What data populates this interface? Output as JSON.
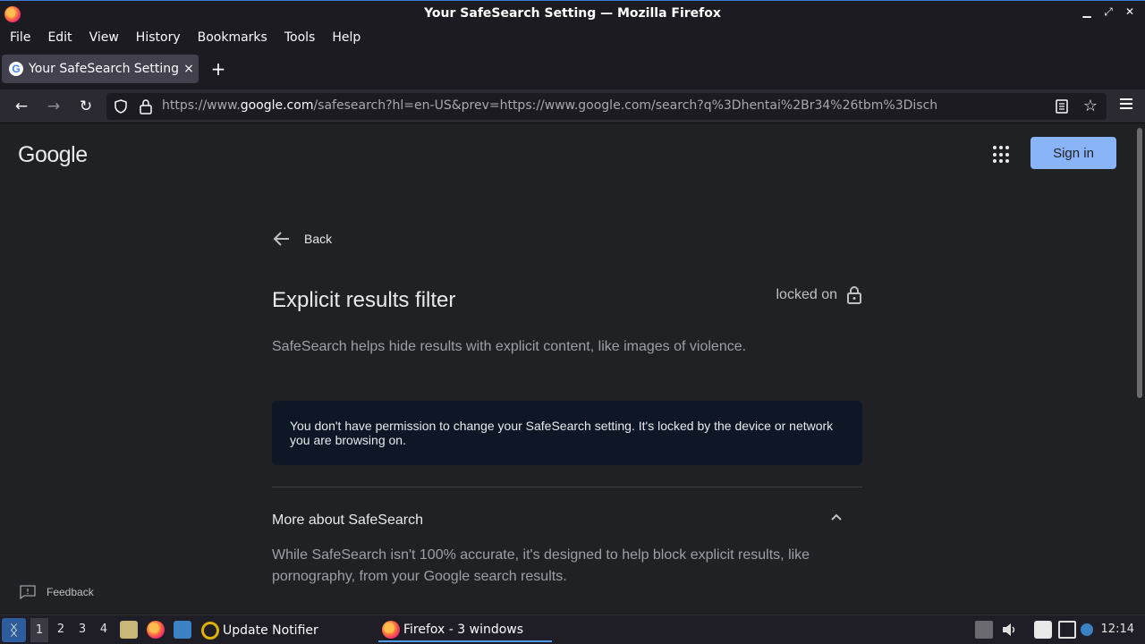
{
  "window": {
    "title": "Your SafeSearch Setting — Mozilla Firefox",
    "controls": {
      "minimize": "▁",
      "restore": "⤢",
      "close": "✕"
    }
  },
  "menu": {
    "file": "File",
    "edit": "Edit",
    "view": "View",
    "history": "History",
    "bookmarks": "Bookmarks",
    "tools": "Tools",
    "help": "Help"
  },
  "tab": {
    "label": "Your SafeSearch Setting",
    "close": "×",
    "favicon": "G"
  },
  "newtab": "+",
  "nav": {
    "back": "←",
    "forward": "→",
    "reload": "↻",
    "url_prefix": "https://www.",
    "url_domain": "google.com",
    "url_rest": "/safesearch?hl=en-US&prev=https://www.google.com/search?q%3Dhentai%2Br34%26tbm%3Disch",
    "star": "☆"
  },
  "page": {
    "logo": "Google",
    "signin": "Sign in",
    "back": "Back",
    "title": "Explicit results filter",
    "locked_label": "locked on",
    "description": "SafeSearch helps hide results with explicit content, like images of violence.",
    "notice": "You don't have permission to change your SafeSearch setting. It's locked by the device or network you are browsing on.",
    "more_title": "More about SafeSearch",
    "more_body": "While SafeSearch isn't 100% accurate, it's designed to help block explicit results, like pornography, from your Google search results.",
    "feedback": "Feedback"
  },
  "taskbar": {
    "workspaces": [
      "1",
      "2",
      "3",
      "4"
    ],
    "update_notifier": "Update Notifier",
    "firefox_task": "Firefox - 3 windows",
    "clock": "12:14"
  },
  "colors": {
    "accent": "#8ab4f8",
    "notice_bg": "#0e1726",
    "page_bg": "#202124"
  }
}
